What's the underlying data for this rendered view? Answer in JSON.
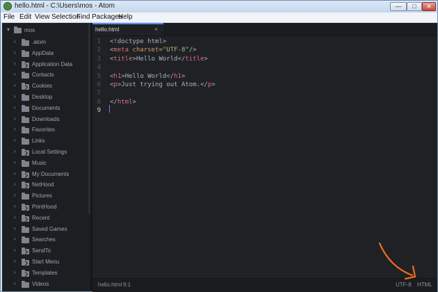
{
  "window": {
    "title": "hello.html - C:\\Users\\mos - Atom",
    "min_glyph": "—",
    "max_glyph": "□",
    "close_glyph": "✕"
  },
  "menu": [
    {
      "label": "File"
    },
    {
      "label": "Edit"
    },
    {
      "label": "View"
    },
    {
      "label": "Selection"
    },
    {
      "label": "Find"
    },
    {
      "label": "Packages"
    },
    {
      "label": "Help"
    }
  ],
  "tree": {
    "root": {
      "label": "mos",
      "chevron": "▾"
    },
    "chevron": "›",
    "items": [
      {
        "label": ".atom",
        "link": false
      },
      {
        "label": "AppData",
        "link": false
      },
      {
        "label": "Application Data",
        "link": true
      },
      {
        "label": "Contacts",
        "link": false
      },
      {
        "label": "Cookies",
        "link": true
      },
      {
        "label": "Desktop",
        "link": false
      },
      {
        "label": "Documents",
        "link": false
      },
      {
        "label": "Downloads",
        "link": false
      },
      {
        "label": "Favorites",
        "link": false
      },
      {
        "label": "Links",
        "link": false
      },
      {
        "label": "Local Settings",
        "link": true
      },
      {
        "label": "Music",
        "link": false
      },
      {
        "label": "My Documents",
        "link": true
      },
      {
        "label": "NetHood",
        "link": true
      },
      {
        "label": "Pictures",
        "link": false
      },
      {
        "label": "PrintHood",
        "link": true
      },
      {
        "label": "Recent",
        "link": true
      },
      {
        "label": "Saved Games",
        "link": false
      },
      {
        "label": "Searches",
        "link": false
      },
      {
        "label": "SendTo",
        "link": true
      },
      {
        "label": "Start Menu",
        "link": true
      },
      {
        "label": "Templates",
        "link": true
      },
      {
        "label": "Videos",
        "link": false
      }
    ]
  },
  "tab": {
    "label": "hello.html",
    "close": "×"
  },
  "editor": {
    "line_numbers": [
      "1",
      "2",
      "3",
      "4",
      "5",
      "6",
      "7",
      "8",
      "9"
    ],
    "active_line": 9,
    "lines": [
      [
        {
          "t": "<!doctype html>",
          "c": "pun"
        }
      ],
      [
        {
          "t": "<",
          "c": "pun"
        },
        {
          "t": "meta",
          "c": "tag"
        },
        {
          "t": " charset",
          "c": "attr"
        },
        {
          "t": "=",
          "c": "pun"
        },
        {
          "t": "\"UTF-8\"",
          "c": "str"
        },
        {
          "t": "/>",
          "c": "pun"
        }
      ],
      [
        {
          "t": "<",
          "c": "pun"
        },
        {
          "t": "title",
          "c": "tag"
        },
        {
          "t": ">",
          "c": "pun"
        },
        {
          "t": "Hello World",
          "c": "txt"
        },
        {
          "t": "</",
          "c": "pun"
        },
        {
          "t": "title",
          "c": "tag"
        },
        {
          "t": ">",
          "c": "pun"
        }
      ],
      [],
      [
        {
          "t": "<",
          "c": "pun"
        },
        {
          "t": "h1",
          "c": "tag"
        },
        {
          "t": ">",
          "c": "pun"
        },
        {
          "t": "Hello World",
          "c": "txt"
        },
        {
          "t": "</",
          "c": "pun"
        },
        {
          "t": "h1",
          "c": "tag"
        },
        {
          "t": ">",
          "c": "pun"
        }
      ],
      [
        {
          "t": "<",
          "c": "pun"
        },
        {
          "t": "p",
          "c": "tag"
        },
        {
          "t": ">",
          "c": "pun"
        },
        {
          "t": "Just trying out Atom.",
          "c": "txt"
        },
        {
          "t": "</",
          "c": "pun"
        },
        {
          "t": "p",
          "c": "tag"
        },
        {
          "t": ">",
          "c": "pun"
        }
      ],
      [],
      [
        {
          "t": "</",
          "c": "pun"
        },
        {
          "t": "html",
          "c": "tag"
        },
        {
          "t": ">",
          "c": "pun"
        }
      ],
      []
    ]
  },
  "status": {
    "file": "hello.html",
    "position": "9:1",
    "encoding": "UTF-8",
    "grammar": "HTML"
  },
  "colors": {
    "annotation_arrow": "#f26b1d",
    "accent": "#568af2"
  }
}
